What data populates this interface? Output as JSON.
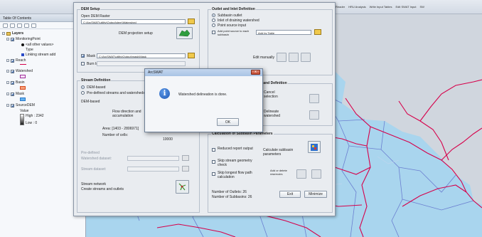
{
  "topbar": {
    "menu_items": [
      "Reader",
      "HRU Analysis",
      "Write Input Tables",
      "Edit SWAT Input",
      "SW"
    ]
  },
  "toc": {
    "title": "Table Of Contents",
    "tree": {
      "layers": "Layers",
      "monitoring_point": "MonitoringPoint",
      "all_other_values": "<all other values>",
      "type": "Type",
      "linking_stream": "Linking stream add",
      "reach": "Reach",
      "watershed": "Watershed",
      "basin": "Basin",
      "mask": "Mask",
      "source_dem": "SourceDEM",
      "value": "Value",
      "high": "High : 2342",
      "low": "Low : 0"
    }
  },
  "dialog": {
    "dem_setup": {
      "title": "DEM Setup",
      "open_dem_raster": "Open DEM Raster",
      "dem_path": "C:\\ArcSWAT\\utility\\Output\\dem\\Watershed",
      "dem_projection_setup": "DEM projection setup",
      "mask_label": "Mask",
      "mask_path": "C:\\ArcSWAT\\utility\\Output\\mask\\Mask",
      "burn_in_label": "Burn In"
    },
    "stream_definition": {
      "title": "Stream Definition",
      "dem_based": "DEM-based",
      "pre_defined": "Pre-defined streams and watersheds",
      "dem_based_heading": "DEM-based",
      "flow_direction": "Flow direction and accumulation",
      "area_label": "Area: [1403 - 2806971]",
      "number_of_cells": "Number of cells:",
      "cells_value": "10000",
      "pre_defined_heading": "Pre-defined",
      "watershed_dataset": "Watershed dataset:",
      "stream_dataset": "Stream dataset:",
      "stream_network": "Stream network",
      "create_streams": "Create streams and outlets"
    },
    "outlet_inlet": {
      "title": "Outlet and Inlet Definition",
      "subbasin_outlet": "Subbasin outlet",
      "inlet_draining": "Inlet of draining watershed",
      "point_source_input": "Point source input",
      "add_point_source": "Add point source to each subbasin",
      "table_label": "Add by Table",
      "edit_manually": "Edit manually"
    },
    "watershed_outlets": {
      "title": "Watershed Outlet(s) Selection and Definition",
      "cancel_selection": "Cancel selection",
      "delineate_watershed": "Delineate watershed"
    },
    "subbasin_params": {
      "title": "Calculation of Subbasin Parameters",
      "reduced_report": "Reduced report output",
      "skip_stream_geometry": "Skip stream geometry check",
      "skip_longest_flow": "Skip longest flow path calculation",
      "calculate_params": "Calculate subbasin parameters",
      "add_or_delete": "Add or delete reservoirs",
      "outlets_count": "Number of Outlets: 26",
      "subbasins_count": "Number of Subbasins: 26",
      "exit_label": "Exit",
      "minimize_label": "Minimize"
    }
  },
  "message_box": {
    "title": "ArcSWAT",
    "text": "Watershed delineation is done.",
    "ok_label": "OK",
    "close_glyph": "x",
    "icon_glyph": "i"
  },
  "colors": {
    "reach": "#d6004a",
    "watershed_fill": "#a9d5ee",
    "watershed_line": "#6b7fd0"
  }
}
